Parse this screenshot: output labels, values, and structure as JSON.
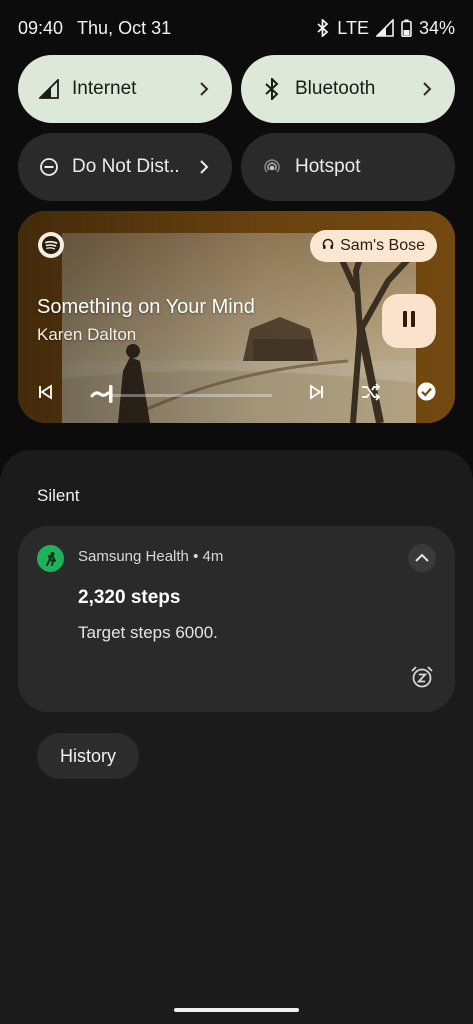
{
  "status_bar": {
    "time": "09:40",
    "date": "Thu, Oct 31",
    "network": "LTE",
    "battery": "34%",
    "icons": [
      "bluetooth-icon",
      "signal-icon",
      "battery-icon"
    ]
  },
  "quick_settings": {
    "tiles": [
      {
        "label": "Internet",
        "icon": "cell-signal-icon",
        "active": true,
        "has_chevron": true
      },
      {
        "label": "Bluetooth",
        "icon": "bluetooth-icon",
        "active": true,
        "has_chevron": true
      },
      {
        "label": "Do Not Dist..",
        "icon": "do-not-disturb-icon",
        "active": false,
        "has_chevron": true
      },
      {
        "label": "Hotspot",
        "icon": "hotspot-icon",
        "active": false,
        "has_chevron": false
      }
    ]
  },
  "media": {
    "app_icon": "spotify-icon",
    "output_device": "Sam's Bose",
    "output_icon": "headphones-icon",
    "title": "Something on Your Mind",
    "artist": "Karen Dalton",
    "progress_fraction": 0.1,
    "controls": [
      "previous-icon",
      "pause-icon",
      "next-icon",
      "shuffle-icon",
      "check-circle-icon"
    ],
    "accent": "#fbe2cd"
  },
  "notifications": {
    "section_label": "Silent",
    "items": [
      {
        "app": "Samsung Health",
        "age": "4m",
        "header": "Samsung Health • 4m",
        "title": "2,320 steps",
        "text": "Target steps 6000.",
        "icon": "samsung-health-icon",
        "icon_color": "#1eb35a"
      }
    ],
    "history_label": "History"
  }
}
